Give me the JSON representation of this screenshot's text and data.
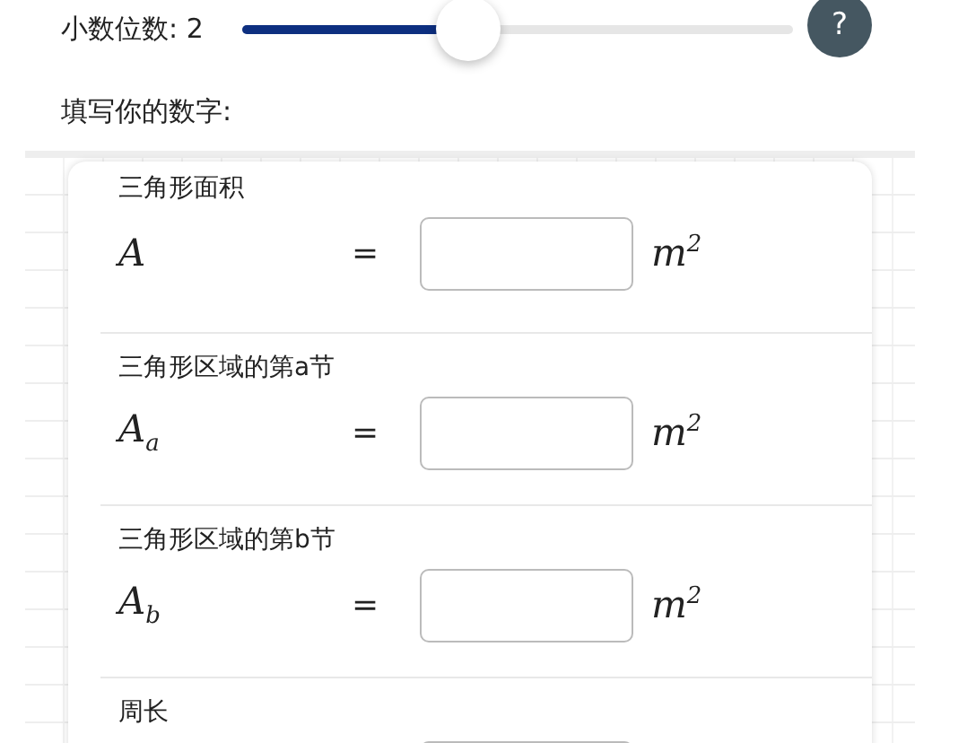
{
  "decimal_slider": {
    "label": "小数位数:",
    "value": "2",
    "level": 0.41
  },
  "help_button": {
    "label": "?"
  },
  "prompt": "填写你的数字:",
  "sections": [
    {
      "label": "三角形面积",
      "symbol": "A",
      "equals": "=",
      "unit": "m$^{2}$"
    },
    {
      "label": "三角形区域的第a节",
      "symbol": "A$_{a}$",
      "equals": "=",
      "unit": "m$^{2}$"
    },
    {
      "label": "三角形区域的第b节",
      "symbol": "A$_{b}$",
      "equals": "=",
      "unit": "m$^{2}$"
    },
    {
      "label": "周长"
    }
  ]
}
